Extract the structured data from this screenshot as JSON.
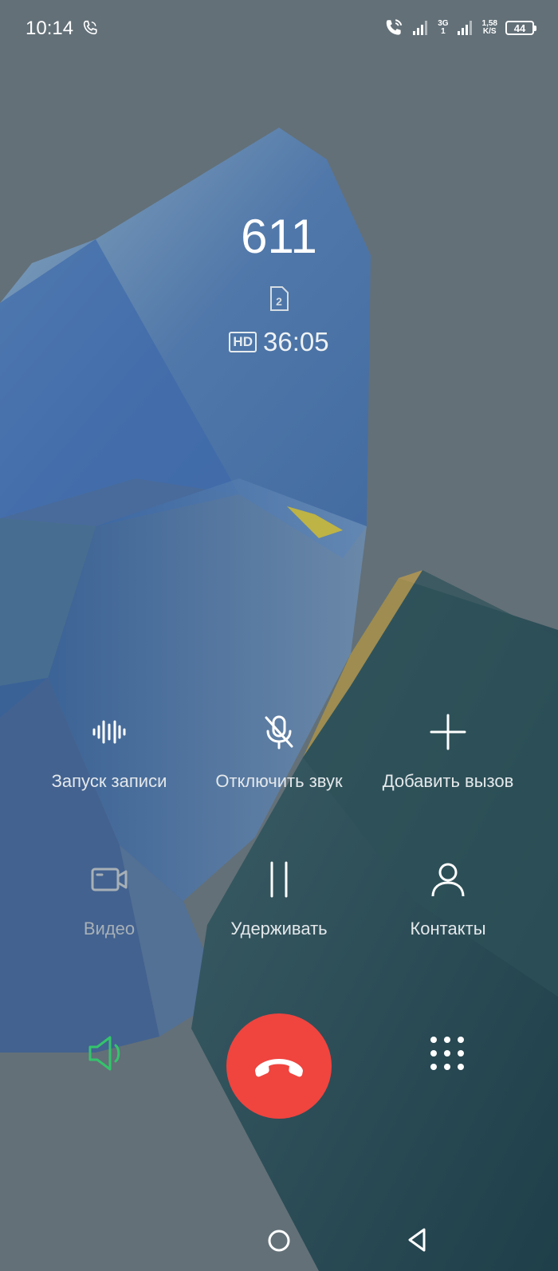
{
  "status_bar": {
    "time": "10:14",
    "network_type": "3G",
    "network_sub": "1",
    "speed_value": "1,58",
    "speed_unit": "K/S",
    "battery_level": "44"
  },
  "call": {
    "number": "611",
    "sim_slot": "2",
    "hd_label": "HD",
    "duration": "36:05"
  },
  "controls": {
    "record_label": "Запуск записи",
    "mute_label": "Отключить звук",
    "add_call_label": "Добавить вызов",
    "video_label": "Видео",
    "hold_label": "Удерживать",
    "contacts_label": "Контакты"
  },
  "bottom_bar": {
    "speaker_icon": "speaker-icon",
    "end_call_icon": "end-call-icon",
    "dialpad_icon": "dialpad-icon"
  },
  "colors": {
    "background": "#637078",
    "end_call": "#f0443f",
    "speaker_active": "#34c46b",
    "disabled": "#a7b0b6"
  }
}
